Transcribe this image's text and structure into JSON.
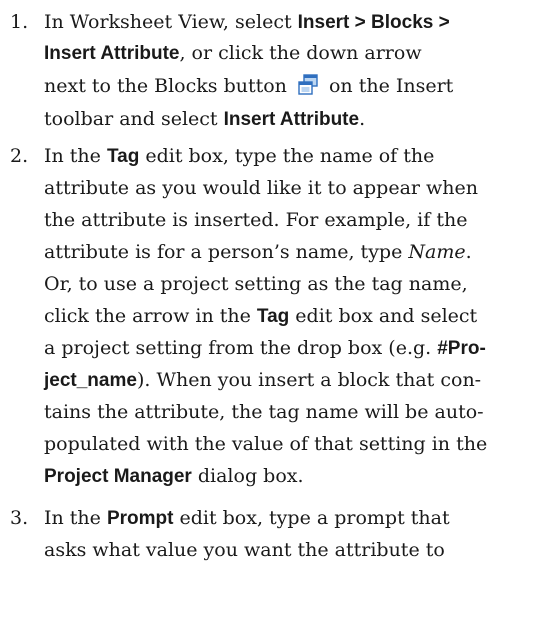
{
  "steps": [
    {
      "number": "1.",
      "lines": [
        {
          "t1": "In Worksheet View, select ",
          "b1": "Insert > Blocks >"
        },
        {
          "b1": "Insert Attribute",
          "t1": ", or click the down arrow"
        },
        {
          "t1": "next to the Blocks button ",
          "t2": " on the Insert"
        },
        {
          "t1": "toolbar and select ",
          "b1": "Insert Attribute",
          "t2": "."
        }
      ],
      "icon": "blocks-icon"
    },
    {
      "number": "2.",
      "lines": [
        {
          "t1": "In the ",
          "b1": "Tag",
          "t2": " edit box, type the name of the"
        },
        {
          "t1": "attribute as you would like it to appear when"
        },
        {
          "t1": "the attribute is inserted. For example, if the"
        },
        {
          "t1": "attribute is for a person’s name, type ",
          "i1": "Name",
          "t2": "."
        },
        {
          "t1": "Or, to use a project setting as the tag name,"
        },
        {
          "t1": "click the arrow in the ",
          "b1": "Tag",
          "t2": " edit box and select"
        },
        {
          "t1": "a project setting from the drop box (e.g. ",
          "b1": "#Pro-"
        },
        {
          "b1": "ject_name",
          "t1": "). When you insert a block that con-"
        },
        {
          "t1": "tains the attribute, the tag name will be auto-"
        },
        {
          "t1": "populated with the value of that setting in the"
        },
        {
          "b1": "Project Manager",
          "t1": " dialog box."
        }
      ]
    },
    {
      "number": "3.",
      "lines": [
        {
          "t1": "In the ",
          "b1": "Prompt",
          "t2": " edit box, type a prompt that"
        },
        {
          "t1": "asks what value you want the attribute to"
        }
      ]
    }
  ],
  "colors": {
    "text": "#1a1a1a",
    "icon_blue": "#2f6fbf",
    "icon_light": "#bcd6f2"
  }
}
